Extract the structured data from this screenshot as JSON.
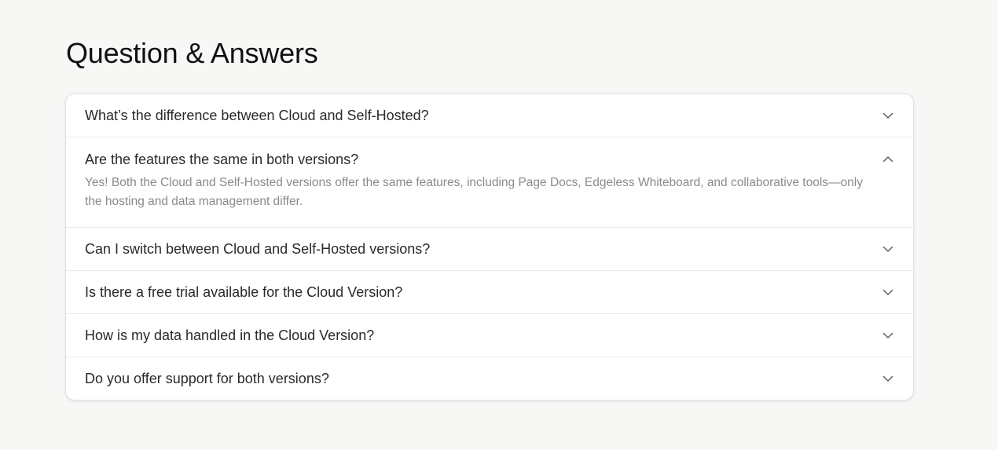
{
  "page": {
    "title": "Question & Answers"
  },
  "faq": {
    "items": [
      {
        "question": "What’s the difference between Cloud and Self-Hosted?",
        "expanded": false,
        "icon": "chevron-down-icon"
      },
      {
        "question": "Are the features the same in both versions?",
        "answer": "Yes! Both the Cloud and Self-Hosted versions offer the same features, including Page Docs, Edgeless Whiteboard, and collaborative tools—only the hosting and data management differ.",
        "expanded": true,
        "icon": "chevron-up-icon"
      },
      {
        "question": "Can I switch between Cloud and Self-Hosted versions?",
        "expanded": false,
        "icon": "chevron-down-icon"
      },
      {
        "question": "Is there a free trial available for the Cloud Version?",
        "expanded": false,
        "icon": "chevron-down-icon"
      },
      {
        "question": "How is my data handled in the Cloud Version?",
        "expanded": false,
        "icon": "chevron-down-icon"
      },
      {
        "question": "Do you offer support for both versions?",
        "expanded": false,
        "icon": "chevron-down-icon"
      }
    ]
  },
  "colors": {
    "background": "#f7f7f6",
    "card": "#ffffff",
    "question_text": "#2a2a2a",
    "answer_text": "#8a8a8a",
    "divider": "#e8e8e8"
  }
}
